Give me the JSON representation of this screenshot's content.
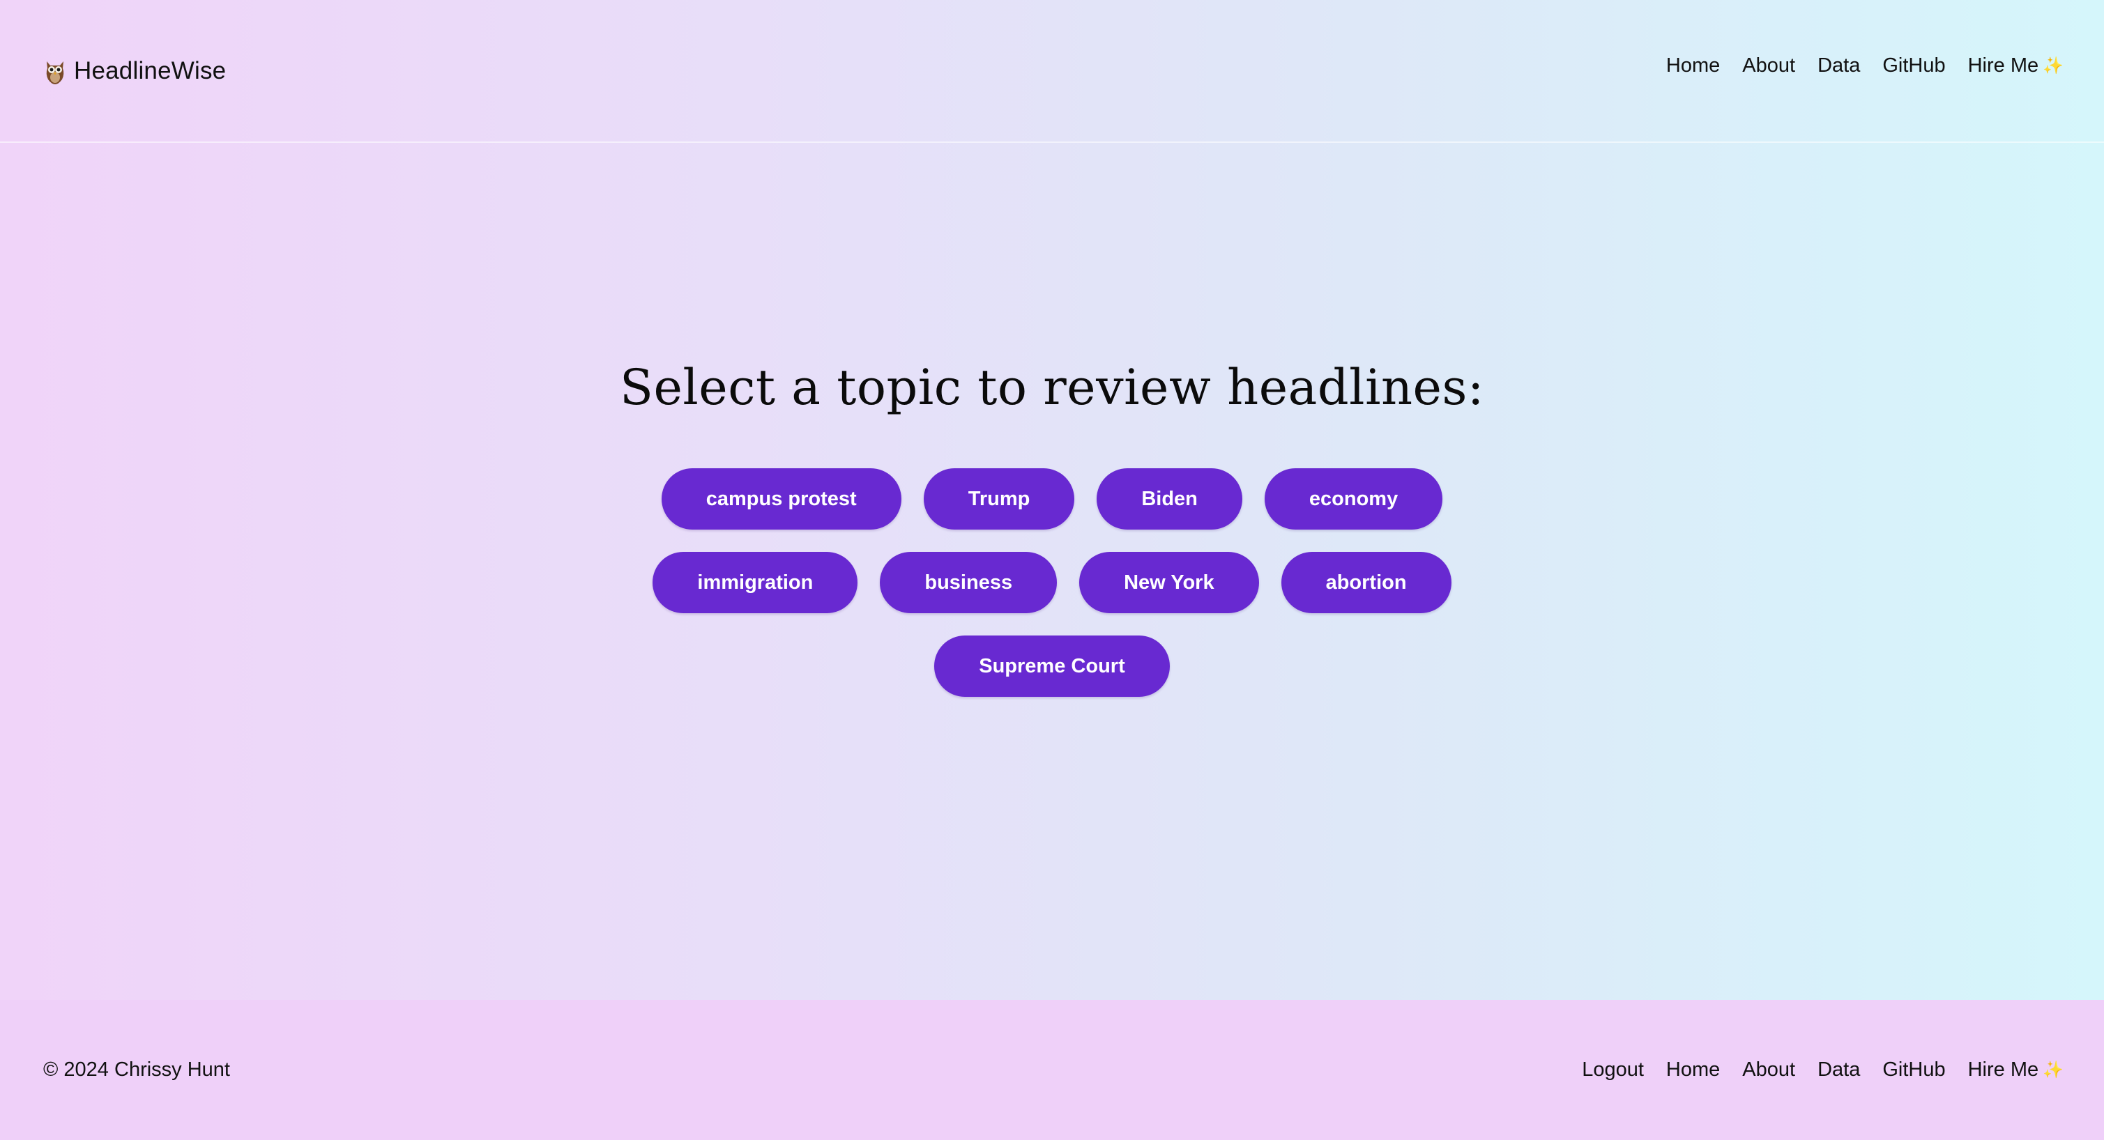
{
  "header": {
    "brand_icon": "owl-icon",
    "brand_name": "HeadlineWise",
    "nav": [
      {
        "label": "Home"
      },
      {
        "label": "About"
      },
      {
        "label": "Data"
      },
      {
        "label": "GitHub"
      },
      {
        "label": "Hire Me",
        "icon": "sparkle-icon",
        "icon_glyph": "✨"
      }
    ]
  },
  "main": {
    "title": "Select a topic to review headlines:",
    "topics": [
      "campus protest",
      "Trump",
      "Biden",
      "economy",
      "immigration",
      "business",
      "New York",
      "abortion",
      "Supreme Court"
    ]
  },
  "footer": {
    "copyright": "© 2024 Chrissy Hunt",
    "nav": [
      {
        "label": "Logout"
      },
      {
        "label": "Home"
      },
      {
        "label": "About"
      },
      {
        "label": "Data"
      },
      {
        "label": "GitHub"
      },
      {
        "label": "Hire Me",
        "icon": "sparkle-icon",
        "icon_glyph": "✨"
      }
    ]
  },
  "colors": {
    "accent": "#6829d1",
    "footer_bg": "#efd0f9"
  }
}
